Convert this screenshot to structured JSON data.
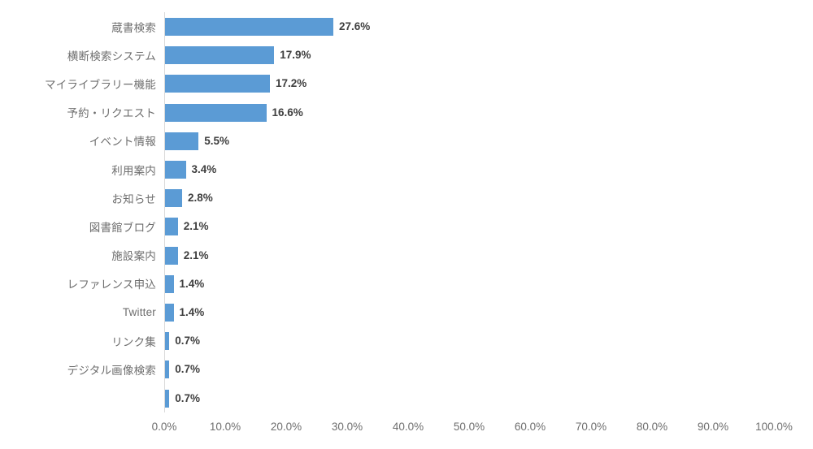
{
  "chart_data": {
    "type": "bar",
    "orientation": "horizontal",
    "title": "",
    "subtitle": "",
    "xlabel": "",
    "ylabel": "",
    "xlim": [
      0,
      100
    ],
    "xtick_labels": [
      "0.0%",
      "10.0%",
      "20.0%",
      "30.0%",
      "40.0%",
      "50.0%",
      "60.0%",
      "70.0%",
      "80.0%",
      "90.0%",
      "100.0%"
    ],
    "xtick_values": [
      0,
      10,
      20,
      30,
      40,
      50,
      60,
      70,
      80,
      90,
      100
    ],
    "grid": false,
    "legend": false,
    "legend_position": "none",
    "bar_color": "#5B9BD5",
    "axis_color": "#D9D9D9",
    "label_color": "#6E6E6E",
    "value_color": "#3F3F3F",
    "categories": [
      "蔵書検索",
      "横断検索システム",
      "マイライブラリー機能",
      "予約・リクエスト",
      "イベント情報",
      "利用案内",
      "お知らせ",
      "図書館ブログ",
      "施設案内",
      "レファレンス申込",
      "Twitter",
      "リンク集",
      "デジタル画像検索",
      ""
    ],
    "values": [
      27.6,
      17.9,
      17.2,
      16.6,
      5.5,
      3.4,
      2.8,
      2.1,
      2.1,
      1.4,
      1.4,
      0.7,
      0.7,
      0.7
    ],
    "value_labels": [
      "27.6%",
      "17.9%",
      "17.2%",
      "16.6%",
      "5.5%",
      "3.4%",
      "2.8%",
      "2.1%",
      "2.1%",
      "1.4%",
      "1.4%",
      "0.7%",
      "0.7%",
      "0.7%"
    ]
  }
}
